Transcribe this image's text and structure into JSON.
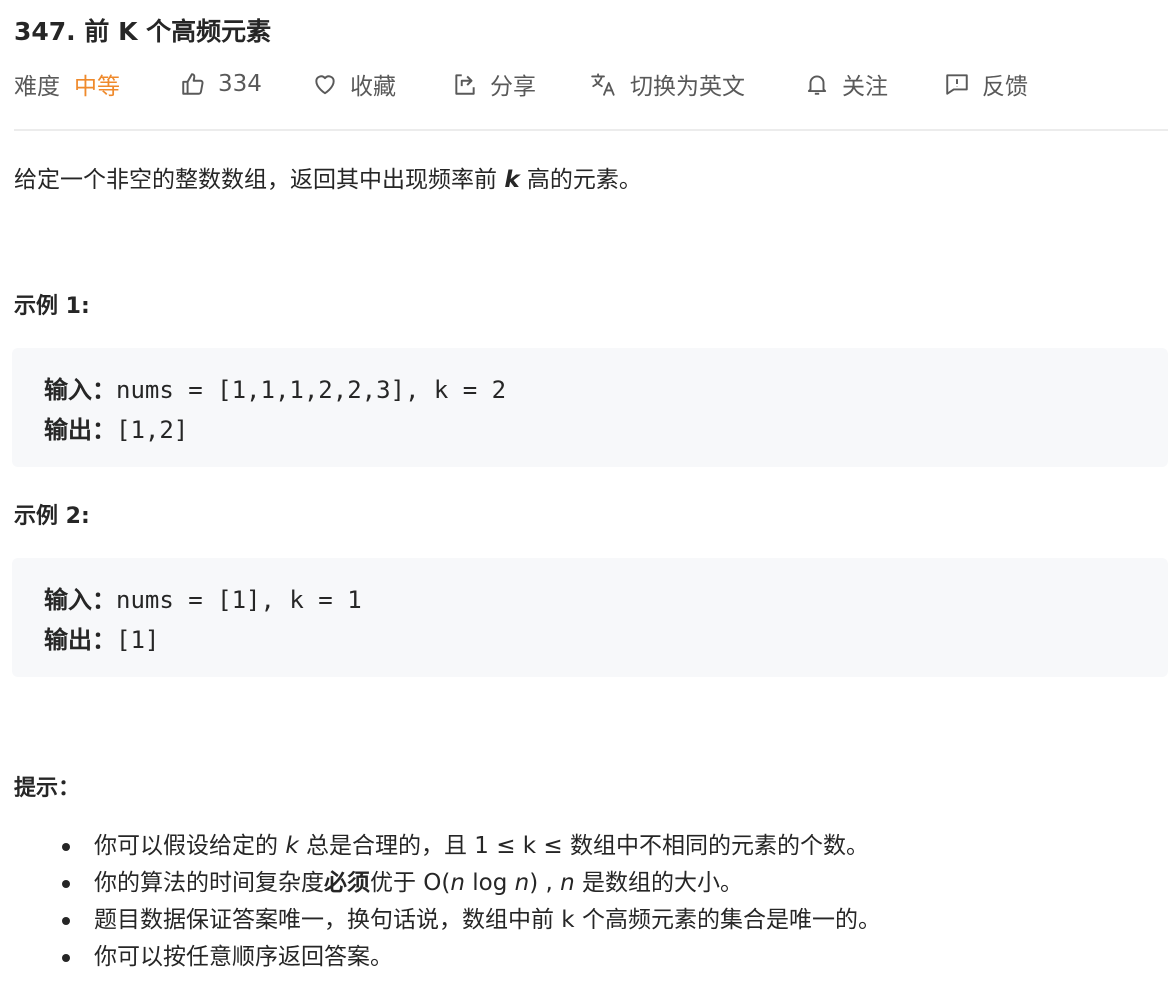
{
  "problem": {
    "title": "347. 前 K 个高频元素"
  },
  "meta": {
    "difficulty_label": "难度",
    "difficulty_value": "中等",
    "likes": "334",
    "favorite_label": "收藏",
    "share_label": "分享",
    "translate_label": "切换为英文",
    "follow_label": "关注",
    "feedback_label": "反馈",
    "accent_color": "#ef8a2c"
  },
  "description": {
    "before_k": "给定一个非空的整数数组，返回其中出现频率前",
    "k": "k",
    "after_k": "高的元素。"
  },
  "examples": [
    {
      "title": "示例 1:",
      "input_label": "输入：",
      "input_value": "nums = [1,1,1,2,2,3], k = 2",
      "output_label": "输出：",
      "output_value": "[1,2]"
    },
    {
      "title": "示例 2:",
      "input_label": "输入：",
      "input_value": "nums = [1], k = 1",
      "output_label": "输出：",
      "output_value": "[1]"
    }
  ],
  "hints": {
    "title": "提示：",
    "items": {
      "h1_a": "你可以假设给定的 ",
      "h1_k": "k",
      "h1_b": " 总是合理的，且 1 ≤ k ≤ 数组中不相同的元素的个数。",
      "h2_a": "你的算法的时间复杂度",
      "h2_strong": "必须",
      "h2_b": "优于 O(",
      "h2_n1": "n",
      "h2_c": " log ",
      "h2_n2": "n",
      "h2_d": ") , ",
      "h2_n3": "n",
      "h2_e": " 是数组的大小。",
      "h3": "题目数据保证答案唯一，换句话说，数组中前 k 个高频元素的集合是唯一的。",
      "h4": "你可以按任意顺序返回答案。"
    }
  }
}
